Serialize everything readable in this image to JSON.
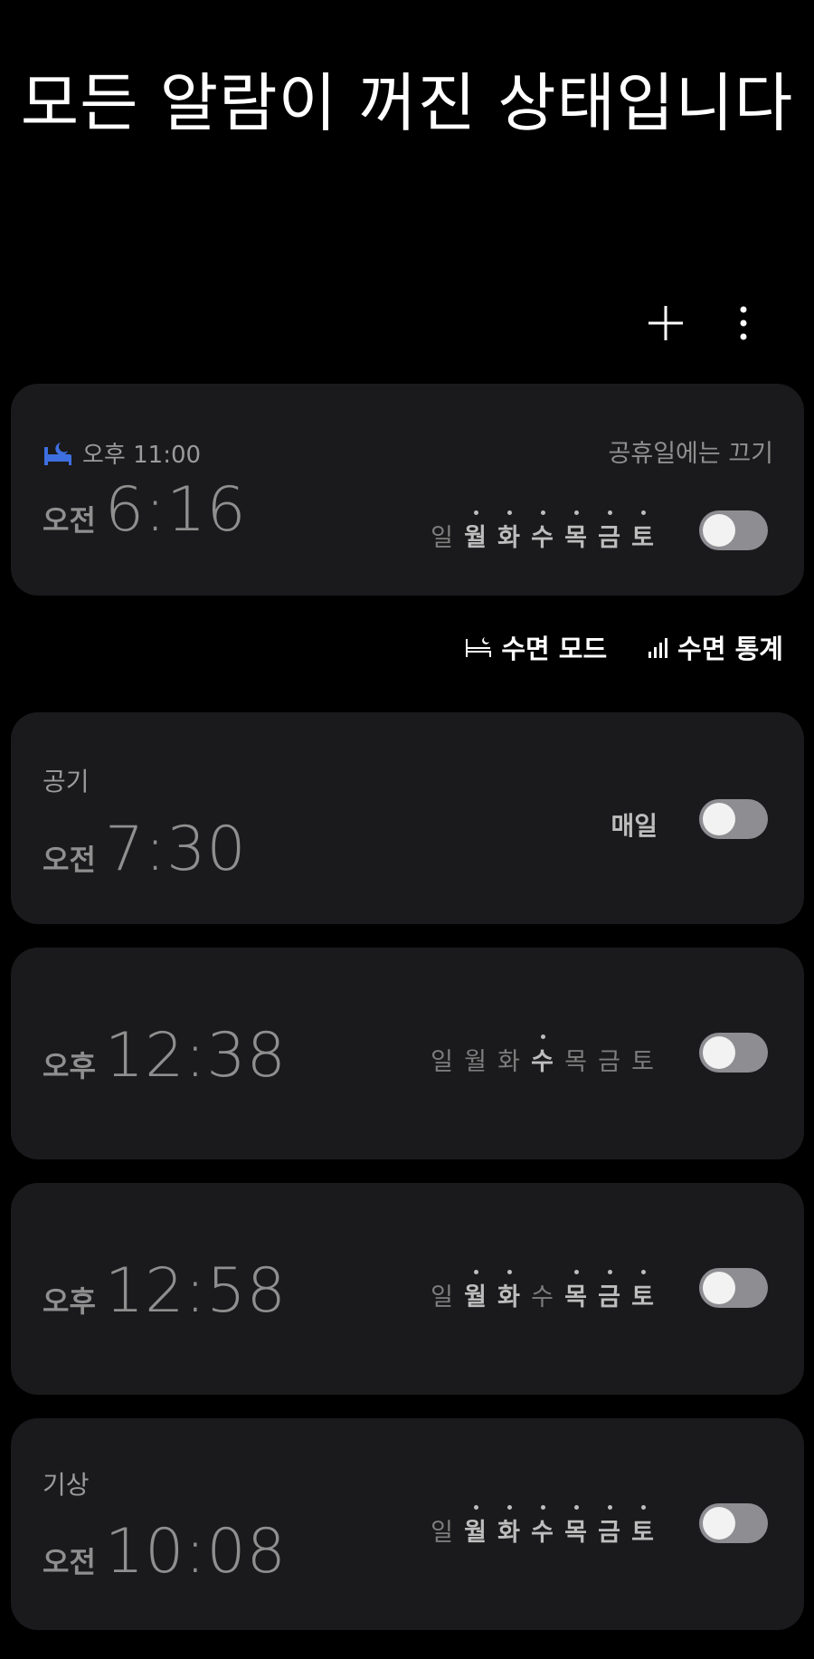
{
  "header": {
    "title": "모든 알람이 꺼진 상태입니다"
  },
  "toolbar": {
    "add_icon": "plus-icon",
    "more_icon": "more-vertical-icon"
  },
  "colors": {
    "card_bg": "#1a1a1c",
    "toggle_off": "#8e8e92",
    "bedtime_icon": "#3e6fe0"
  },
  "weekday_labels": [
    "일",
    "월",
    "화",
    "수",
    "목",
    "금",
    "토"
  ],
  "sleep_card": {
    "bedtime": "오후 11:00",
    "holiday_text": "공휴일에는 끄기",
    "ampm": "오전",
    "time": "6:16",
    "days_on": [
      false,
      true,
      true,
      true,
      true,
      true,
      true
    ],
    "enabled": false
  },
  "links": {
    "sleep_mode": "수면 모드",
    "sleep_stats": "수면 통계"
  },
  "alarms": [
    {
      "label": "공기",
      "ampm": "오전",
      "time": "7:30",
      "repeat_text": "매일",
      "enabled": false
    },
    {
      "label": "",
      "ampm": "오후",
      "time": "12:38",
      "days_on": [
        false,
        false,
        false,
        true,
        false,
        false,
        false
      ],
      "enabled": false
    },
    {
      "label": "",
      "ampm": "오후",
      "time": "12:58",
      "days_on": [
        false,
        true,
        true,
        false,
        true,
        true,
        true
      ],
      "enabled": false
    },
    {
      "label": "기상",
      "ampm": "오전",
      "time": "10:08",
      "days_on": [
        false,
        true,
        true,
        true,
        true,
        true,
        true
      ],
      "enabled": false
    }
  ]
}
